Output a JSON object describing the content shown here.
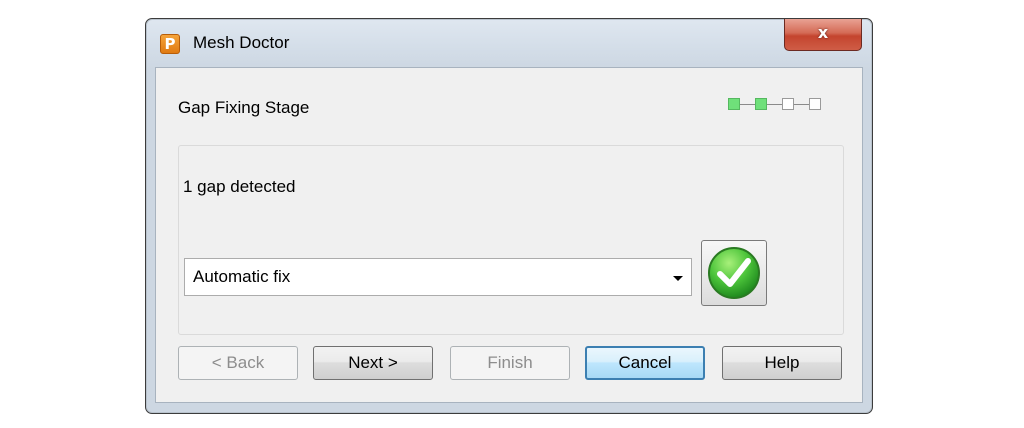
{
  "window": {
    "title": "Mesh Doctor",
    "app_icon_letter": "P",
    "close_label": "x"
  },
  "stage": {
    "title": "Gap Fixing Stage",
    "progress": {
      "total_steps": 4,
      "completed_steps": 2,
      "done_color": "#6fe07a"
    }
  },
  "panel": {
    "status_text": "1 gap detected",
    "fix_method": {
      "selected": "Automatic fix"
    },
    "apply_icon": "green-check-icon"
  },
  "buttons": {
    "back": "< Back",
    "next": "Next >",
    "finish": "Finish",
    "cancel": "Cancel",
    "help": "Help"
  }
}
